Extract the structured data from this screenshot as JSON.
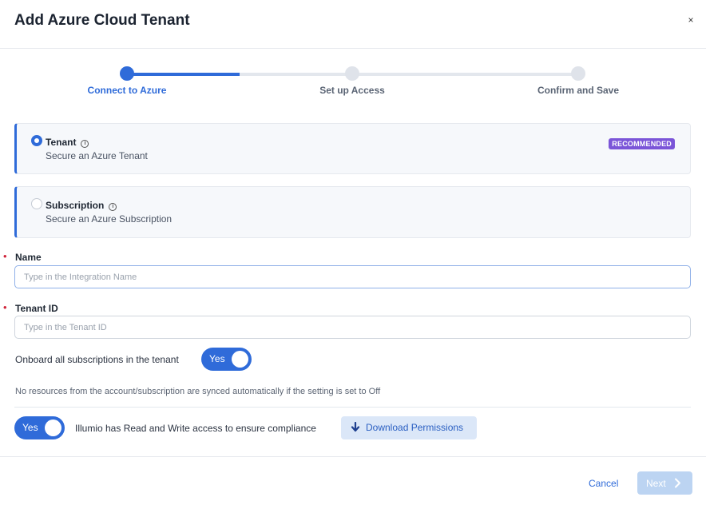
{
  "modal": {
    "title": "Add Azure Cloud Tenant",
    "close_glyph": "×"
  },
  "stepper": {
    "steps": [
      {
        "label": "Connect to Azure",
        "state": "active"
      },
      {
        "label": "Set up Access",
        "state": "pending"
      },
      {
        "label": "Confirm and Save",
        "state": "pending"
      }
    ],
    "progress": 0.25
  },
  "scope_options": [
    {
      "title": "Tenant",
      "subtitle": "Secure an Azure Tenant",
      "selected": true,
      "badge": "RECOMMENDED"
    },
    {
      "title": "Subscription",
      "subtitle": "Secure an Azure Subscription",
      "selected": false
    }
  ],
  "form": {
    "name": {
      "label": "Name",
      "placeholder": "Type in the Integration Name",
      "value": ""
    },
    "tenant_id": {
      "label": "Tenant ID",
      "placeholder": "Type in the Tenant ID",
      "value": ""
    },
    "onboard_all": {
      "label": "Onboard all subscriptions in the tenant",
      "toggle": "Yes"
    },
    "sync_note": "No resources from the account/subscription are synced automatically if the setting is set to Off",
    "access": {
      "toggle": "Yes",
      "label": "Illumio has Read and Write access to ensure compliance"
    },
    "download_label": "Download Permissions"
  },
  "footer": {
    "cancel_label": "Cancel",
    "next_label": "Next"
  },
  "colors": {
    "accent": "#2f6bd9",
    "badge": "#7b55d8",
    "required": "#d0243a",
    "next_disabled": "#bcd4f2"
  },
  "icons": {
    "close": "close-icon",
    "info": "info-icon",
    "download": "download-arrow-icon",
    "next": "chevron-right-icon"
  }
}
